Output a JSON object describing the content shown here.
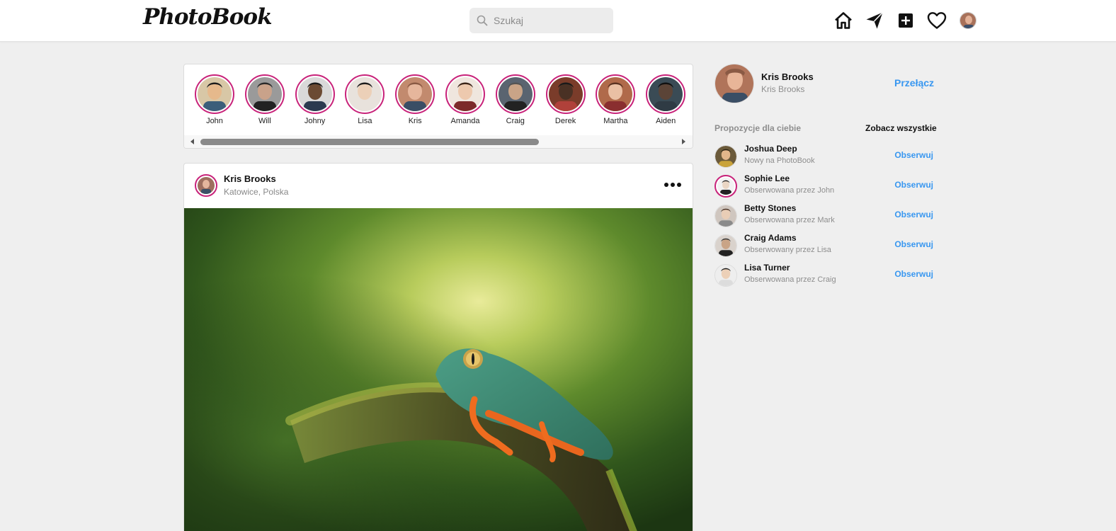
{
  "app": {
    "logo": "PhotoBook"
  },
  "search": {
    "placeholder": "Szukaj"
  },
  "nav": {
    "icons": [
      "home-icon",
      "send-icon",
      "add-post-icon",
      "heart-icon",
      "profile-avatar"
    ]
  },
  "stories": [
    {
      "name": "John"
    },
    {
      "name": "Will"
    },
    {
      "name": "Johny"
    },
    {
      "name": "Lisa"
    },
    {
      "name": "Kris"
    },
    {
      "name": "Amanda"
    },
    {
      "name": "Craig"
    },
    {
      "name": "Derek"
    },
    {
      "name": "Martha"
    },
    {
      "name": "Aiden"
    }
  ],
  "post": {
    "user": "Kris Brooks",
    "location": "Katowice, Polska"
  },
  "sidebar": {
    "me": {
      "name": "Kris Brooks",
      "handle": "Kris Brooks",
      "switch_label": "Przełącz"
    },
    "suggestions_title": "Propozycje dla ciebie",
    "see_all_label": "Zobacz wszystkie",
    "suggestions": [
      {
        "name": "Joshua Deep",
        "sub": "Nowy na PhotoBook",
        "action": "Obserwuj"
      },
      {
        "name": "Sophie Lee",
        "sub": "Obserwowana przez John",
        "action": "Obserwuj"
      },
      {
        "name": "Betty Stones",
        "sub": "Obserwowana przez Mark",
        "action": "Obserwuj"
      },
      {
        "name": "Craig Adams",
        "sub": "Obserwowany przez Lisa",
        "action": "Obserwuj"
      },
      {
        "name": "Lisa Turner",
        "sub": "Obserwowana przez Craig",
        "action": "Obserwuj"
      }
    ]
  },
  "colors": {
    "story_ring": "#c8237a",
    "link_blue": "#3897f0",
    "background": "#efefef"
  }
}
